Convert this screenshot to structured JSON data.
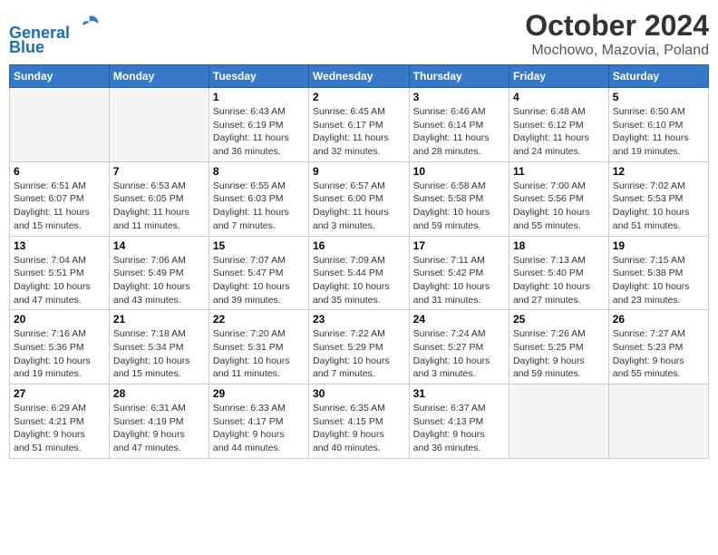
{
  "header": {
    "logo_line1": "General",
    "logo_line2": "Blue",
    "month": "October 2024",
    "location": "Mochowo, Mazovia, Poland"
  },
  "weekdays": [
    "Sunday",
    "Monday",
    "Tuesday",
    "Wednesday",
    "Thursday",
    "Friday",
    "Saturday"
  ],
  "weeks": [
    [
      {
        "day": "",
        "content": ""
      },
      {
        "day": "",
        "content": ""
      },
      {
        "day": "1",
        "content": "Sunrise: 6:43 AM\nSunset: 6:19 PM\nDaylight: 11 hours\nand 36 minutes."
      },
      {
        "day": "2",
        "content": "Sunrise: 6:45 AM\nSunset: 6:17 PM\nDaylight: 11 hours\nand 32 minutes."
      },
      {
        "day": "3",
        "content": "Sunrise: 6:46 AM\nSunset: 6:14 PM\nDaylight: 11 hours\nand 28 minutes."
      },
      {
        "day": "4",
        "content": "Sunrise: 6:48 AM\nSunset: 6:12 PM\nDaylight: 11 hours\nand 24 minutes."
      },
      {
        "day": "5",
        "content": "Sunrise: 6:50 AM\nSunset: 6:10 PM\nDaylight: 11 hours\nand 19 minutes."
      }
    ],
    [
      {
        "day": "6",
        "content": "Sunrise: 6:51 AM\nSunset: 6:07 PM\nDaylight: 11 hours\nand 15 minutes."
      },
      {
        "day": "7",
        "content": "Sunrise: 6:53 AM\nSunset: 6:05 PM\nDaylight: 11 hours\nand 11 minutes."
      },
      {
        "day": "8",
        "content": "Sunrise: 6:55 AM\nSunset: 6:03 PM\nDaylight: 11 hours\nand 7 minutes."
      },
      {
        "day": "9",
        "content": "Sunrise: 6:57 AM\nSunset: 6:00 PM\nDaylight: 11 hours\nand 3 minutes."
      },
      {
        "day": "10",
        "content": "Sunrise: 6:58 AM\nSunset: 5:58 PM\nDaylight: 10 hours\nand 59 minutes."
      },
      {
        "day": "11",
        "content": "Sunrise: 7:00 AM\nSunset: 5:56 PM\nDaylight: 10 hours\nand 55 minutes."
      },
      {
        "day": "12",
        "content": "Sunrise: 7:02 AM\nSunset: 5:53 PM\nDaylight: 10 hours\nand 51 minutes."
      }
    ],
    [
      {
        "day": "13",
        "content": "Sunrise: 7:04 AM\nSunset: 5:51 PM\nDaylight: 10 hours\nand 47 minutes."
      },
      {
        "day": "14",
        "content": "Sunrise: 7:06 AM\nSunset: 5:49 PM\nDaylight: 10 hours\nand 43 minutes."
      },
      {
        "day": "15",
        "content": "Sunrise: 7:07 AM\nSunset: 5:47 PM\nDaylight: 10 hours\nand 39 minutes."
      },
      {
        "day": "16",
        "content": "Sunrise: 7:09 AM\nSunset: 5:44 PM\nDaylight: 10 hours\nand 35 minutes."
      },
      {
        "day": "17",
        "content": "Sunrise: 7:11 AM\nSunset: 5:42 PM\nDaylight: 10 hours\nand 31 minutes."
      },
      {
        "day": "18",
        "content": "Sunrise: 7:13 AM\nSunset: 5:40 PM\nDaylight: 10 hours\nand 27 minutes."
      },
      {
        "day": "19",
        "content": "Sunrise: 7:15 AM\nSunset: 5:38 PM\nDaylight: 10 hours\nand 23 minutes."
      }
    ],
    [
      {
        "day": "20",
        "content": "Sunrise: 7:16 AM\nSunset: 5:36 PM\nDaylight: 10 hours\nand 19 minutes."
      },
      {
        "day": "21",
        "content": "Sunrise: 7:18 AM\nSunset: 5:34 PM\nDaylight: 10 hours\nand 15 minutes."
      },
      {
        "day": "22",
        "content": "Sunrise: 7:20 AM\nSunset: 5:31 PM\nDaylight: 10 hours\nand 11 minutes."
      },
      {
        "day": "23",
        "content": "Sunrise: 7:22 AM\nSunset: 5:29 PM\nDaylight: 10 hours\nand 7 minutes."
      },
      {
        "day": "24",
        "content": "Sunrise: 7:24 AM\nSunset: 5:27 PM\nDaylight: 10 hours\nand 3 minutes."
      },
      {
        "day": "25",
        "content": "Sunrise: 7:26 AM\nSunset: 5:25 PM\nDaylight: 9 hours\nand 59 minutes."
      },
      {
        "day": "26",
        "content": "Sunrise: 7:27 AM\nSunset: 5:23 PM\nDaylight: 9 hours\nand 55 minutes."
      }
    ],
    [
      {
        "day": "27",
        "content": "Sunrise: 6:29 AM\nSunset: 4:21 PM\nDaylight: 9 hours\nand 51 minutes."
      },
      {
        "day": "28",
        "content": "Sunrise: 6:31 AM\nSunset: 4:19 PM\nDaylight: 9 hours\nand 47 minutes."
      },
      {
        "day": "29",
        "content": "Sunrise: 6:33 AM\nSunset: 4:17 PM\nDaylight: 9 hours\nand 44 minutes."
      },
      {
        "day": "30",
        "content": "Sunrise: 6:35 AM\nSunset: 4:15 PM\nDaylight: 9 hours\nand 40 minutes."
      },
      {
        "day": "31",
        "content": "Sunrise: 6:37 AM\nSunset: 4:13 PM\nDaylight: 9 hours\nand 36 minutes."
      },
      {
        "day": "",
        "content": ""
      },
      {
        "day": "",
        "content": ""
      }
    ]
  ]
}
